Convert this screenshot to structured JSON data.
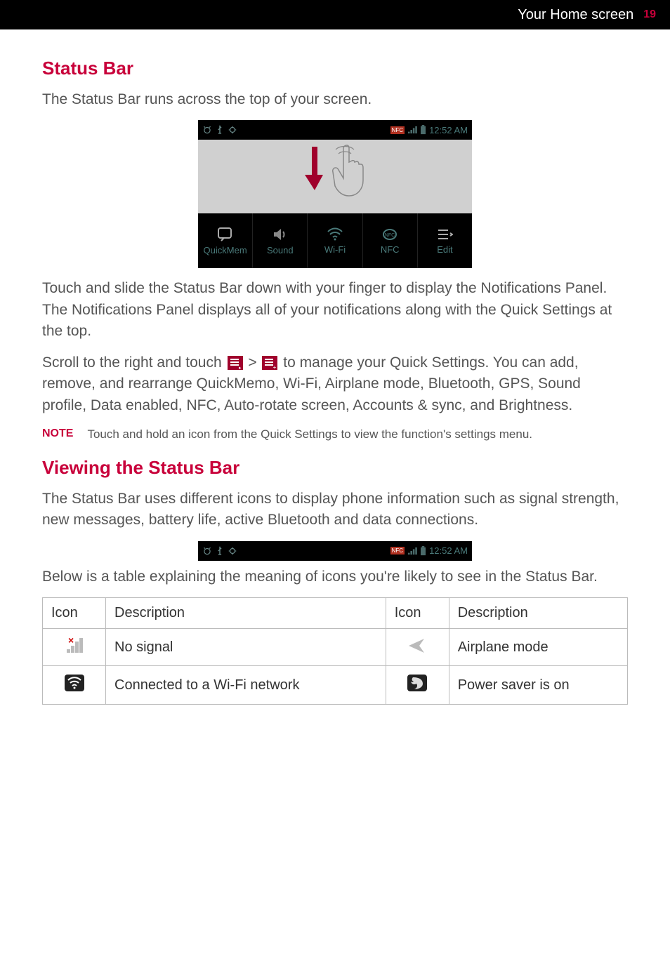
{
  "header": {
    "section_title": "Your Home screen",
    "page_number": "19"
  },
  "section1": {
    "title": "Status Bar",
    "intro": "The Status Bar runs across the top of your screen.",
    "statusbar": {
      "time": "12:52 AM"
    },
    "quick_items": [
      {
        "name": "quickmemo",
        "label": "QuickMem",
        "icon": "quickmemo-icon"
      },
      {
        "name": "sound",
        "label": "Sound",
        "icon": "sound-icon"
      },
      {
        "name": "wifi",
        "label": "Wi-Fi",
        "icon": "wifi-icon"
      },
      {
        "name": "nfc",
        "label": "NFC",
        "icon": "nfc-icon"
      },
      {
        "name": "edit",
        "label": "Edit",
        "icon": "edit-icon"
      }
    ],
    "para1": "Touch and slide the Status Bar down with your finger to display the Notifications Panel. The Notifications Panel displays all of your notifications along with the Quick Settings at the top.",
    "para2_before": "Scroll to the right and touch ",
    "para2_mid": " > ",
    "para2_after": " to manage your Quick Settings. You can add, remove, and rearrange QuickMemo, Wi-Fi, Airplane mode, Bluetooth, GPS, Sound profile, Data enabled, NFC, Auto-rotate screen, Accounts & sync, and Brightness.",
    "note_label": "NOTE",
    "note_text": "Touch and hold an icon from the Quick Settings to view the function's settings menu."
  },
  "section2": {
    "title": "Viewing the Status Bar",
    "para1": "The Status Bar uses different icons to display phone information such as signal strength, new messages, battery life, active Bluetooth and data connections.",
    "statusbar": {
      "time": "12:52 AM"
    },
    "para2": "Below is a table explaining the meaning of icons you're likely to see in the Status Bar."
  },
  "table": {
    "headers": {
      "icon": "Icon",
      "description": "Description"
    },
    "rows": [
      {
        "left_icon": "no-signal-icon",
        "left_desc": "No signal",
        "right_icon": "airplane-mode-icon",
        "right_desc": "Airplane mode"
      },
      {
        "left_icon": "wifi-connected-icon",
        "left_desc": "Connected to a Wi-Fi network",
        "right_icon": "power-saver-icon",
        "right_desc": "Power saver is on"
      }
    ]
  }
}
